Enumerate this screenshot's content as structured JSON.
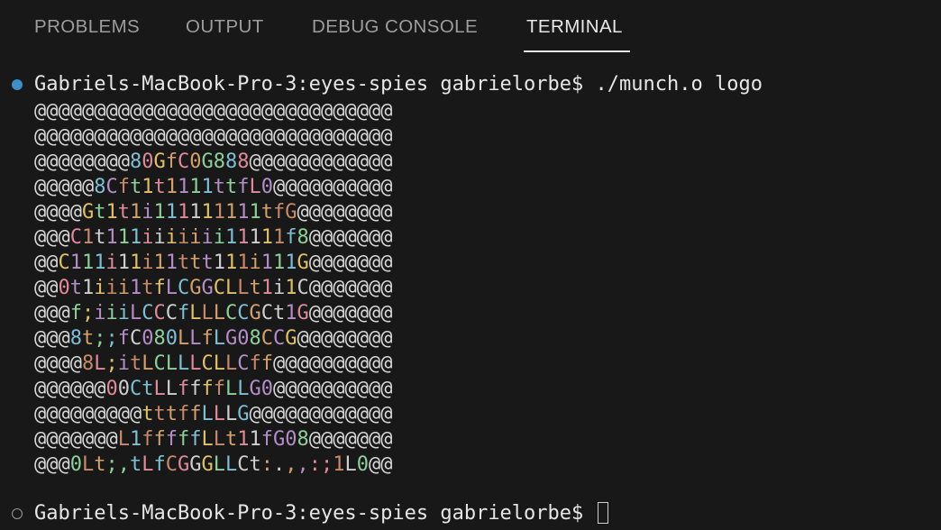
{
  "tabs": [
    {
      "label": "PROBLEMS",
      "active": false
    },
    {
      "label": "OUTPUT",
      "active": false
    },
    {
      "label": "DEBUG CONSOLE",
      "active": false
    },
    {
      "label": "TERMINAL",
      "active": true
    }
  ],
  "terminal": {
    "command_line": "Gabriels-MacBook-Pro-3:eyes-spies gabrielorbe$ ./munch.o logo",
    "output_lines": [
      "@@@@@@@@@@@@@@@@@@@@@@@@@@@@@@",
      "@@@@@@@@@@@@@@@@@@@@@@@@@@@@@@",
      "@@@@@@@@80GfC0G888@@@@@@@@@@@@",
      "@@@@@8Cft1t1111ttfL0@@@@@@@@@@",
      "@@@@Gt1t1i111111111tfG@@@@@@@@",
      "@@@C1t111iiiiiii11111f8@@@@@@@",
      "@@C111i11i11ttt111i111G@@@@@@@",
      "@@0t1iii1tfLCGGCLLt1i1C@@@@@@@",
      "@@@f;iiiLCCCfLLLCCGCt1G@@@@@@@",
      "@@@8t;;fC080LLfLG08CCG@@@@@@@@",
      "@@@@8L;itLCLLLCLLCff@@@@@@@@@@",
      "@@@@@@00CtLLffffLLG0@@@@@@@@@@",
      "@@@@@@@@@tttffLLLG@@@@@@@@@@@@",
      "@@@@@@@L1fffffLLt11fG08@@@@@@@",
      "@@@0Lt;,tLfCGGGLLCt:.,,:;1L0@@"
    ],
    "current_prompt": "Gabriels-MacBook-Pro-3:eyes-spies gabrielorbe$ ",
    "palette": [
      "#cfcfcf",
      "#e0c06a",
      "#c98a6c",
      "#d4a06d",
      "#b58ec9",
      "#8fcf9a",
      "#7fbfd6",
      "#e08a9a"
    ],
    "success_decoration_color": "#3f8fc7",
    "pending_decoration_color": "#9a9a9a"
  },
  "icons": {
    "success_decoration": "circle-filled-icon",
    "pending_decoration": "circle-outline-icon",
    "cursor": "block-cursor-icon"
  }
}
